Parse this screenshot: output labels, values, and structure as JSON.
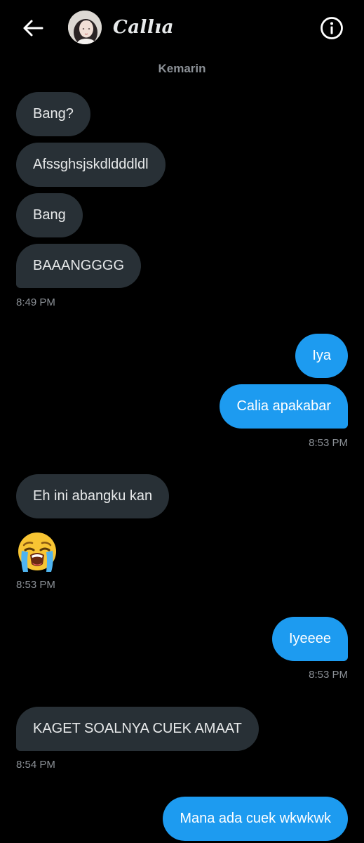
{
  "header": {
    "back_icon": "arrow-left-icon",
    "contact_name": "Callıa",
    "info_icon": "info-circle-icon"
  },
  "date_separator": "Kemarin",
  "messages": [
    {
      "side": "in",
      "text": "Bang?"
    },
    {
      "side": "in",
      "text": "Afssghsjskdldddldl"
    },
    {
      "side": "in",
      "text": "Bang"
    },
    {
      "side": "in",
      "text": "BAAANGGGG"
    },
    {
      "side": "out",
      "text": "Iya"
    },
    {
      "side": "out",
      "text": "Calia apakabar"
    },
    {
      "side": "in",
      "text": "Eh ini abangku kan"
    },
    {
      "side": "in",
      "emoji": "loudly-crying-face"
    },
    {
      "side": "out",
      "text": "Iyeeee"
    },
    {
      "side": "in",
      "text": "KAGET SOALNYA CUEK AMAAT"
    },
    {
      "side": "out",
      "text": "Mana ada cuek wkwkwk"
    }
  ],
  "timestamps": [
    "8:49 PM",
    "8:53 PM",
    "8:53 PM",
    "8:53 PM",
    "8:54 PM"
  ],
  "colors": {
    "background": "#000000",
    "incoming_bubble": "#283036",
    "outgoing_bubble": "#1d9bf0",
    "timestamp": "#8b9096"
  }
}
